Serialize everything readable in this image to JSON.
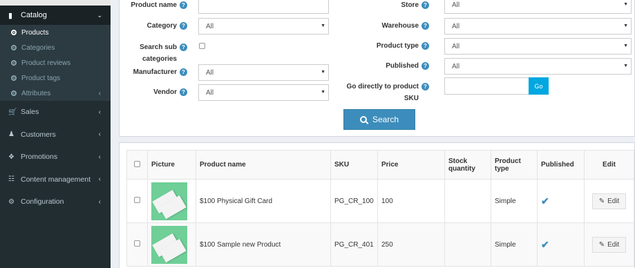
{
  "sidebar": {
    "header": {
      "label": "Catalog",
      "icon": "book-icon"
    },
    "sub_items": [
      {
        "label": "Products",
        "active": true
      },
      {
        "label": "Categories"
      },
      {
        "label": "Product reviews"
      },
      {
        "label": "Product tags"
      },
      {
        "label": "Attributes",
        "has_children": true
      }
    ],
    "items": [
      {
        "label": "Sales",
        "icon": "cart-icon"
      },
      {
        "label": "Customers",
        "icon": "user-icon"
      },
      {
        "label": "Promotions",
        "icon": "tags-icon"
      },
      {
        "label": "Content management",
        "icon": "sitemap-icon"
      },
      {
        "label": "Configuration",
        "icon": "gears-icon"
      }
    ]
  },
  "search": {
    "product_name_label": "Product name",
    "category_label": "Category",
    "category_value": "All",
    "search_sub_label_1": "Search sub",
    "search_sub_label_2": "categories",
    "manufacturer_label": "Manufacturer",
    "manufacturer_value": "All",
    "vendor_label": "Vendor",
    "vendor_value": "All",
    "store_label": "Store",
    "store_value": "All",
    "warehouse_label": "Warehouse",
    "warehouse_value": "All",
    "product_type_label": "Product type",
    "product_type_value": "All",
    "published_label": "Published",
    "published_value": "All",
    "go_sku_label_1": "Go directly to product",
    "go_sku_label_2": "SKU",
    "go_button": "Go",
    "search_button": "Search"
  },
  "table": {
    "headers": {
      "picture": "Picture",
      "name": "Product name",
      "sku": "SKU",
      "price": "Price",
      "stock_1": "Stock",
      "stock_2": "quantity",
      "type": "Product type",
      "published": "Published",
      "edit": "Edit"
    },
    "rows": [
      {
        "name": "$100 Physical Gift Card",
        "sku": "PG_CR_100",
        "price": "100",
        "stock": "",
        "type": "Simple",
        "published": "✔",
        "edit": "Edit"
      },
      {
        "name": "$100 Sample new Product",
        "sku": "PG_CR_401",
        "price": "250",
        "stock": "",
        "type": "Simple",
        "published": "✔",
        "edit": "Edit"
      }
    ]
  },
  "colors": {
    "sidebar_bg": "#222d32",
    "accent": "#3c8dbc",
    "go_button": "#00a7e0"
  }
}
